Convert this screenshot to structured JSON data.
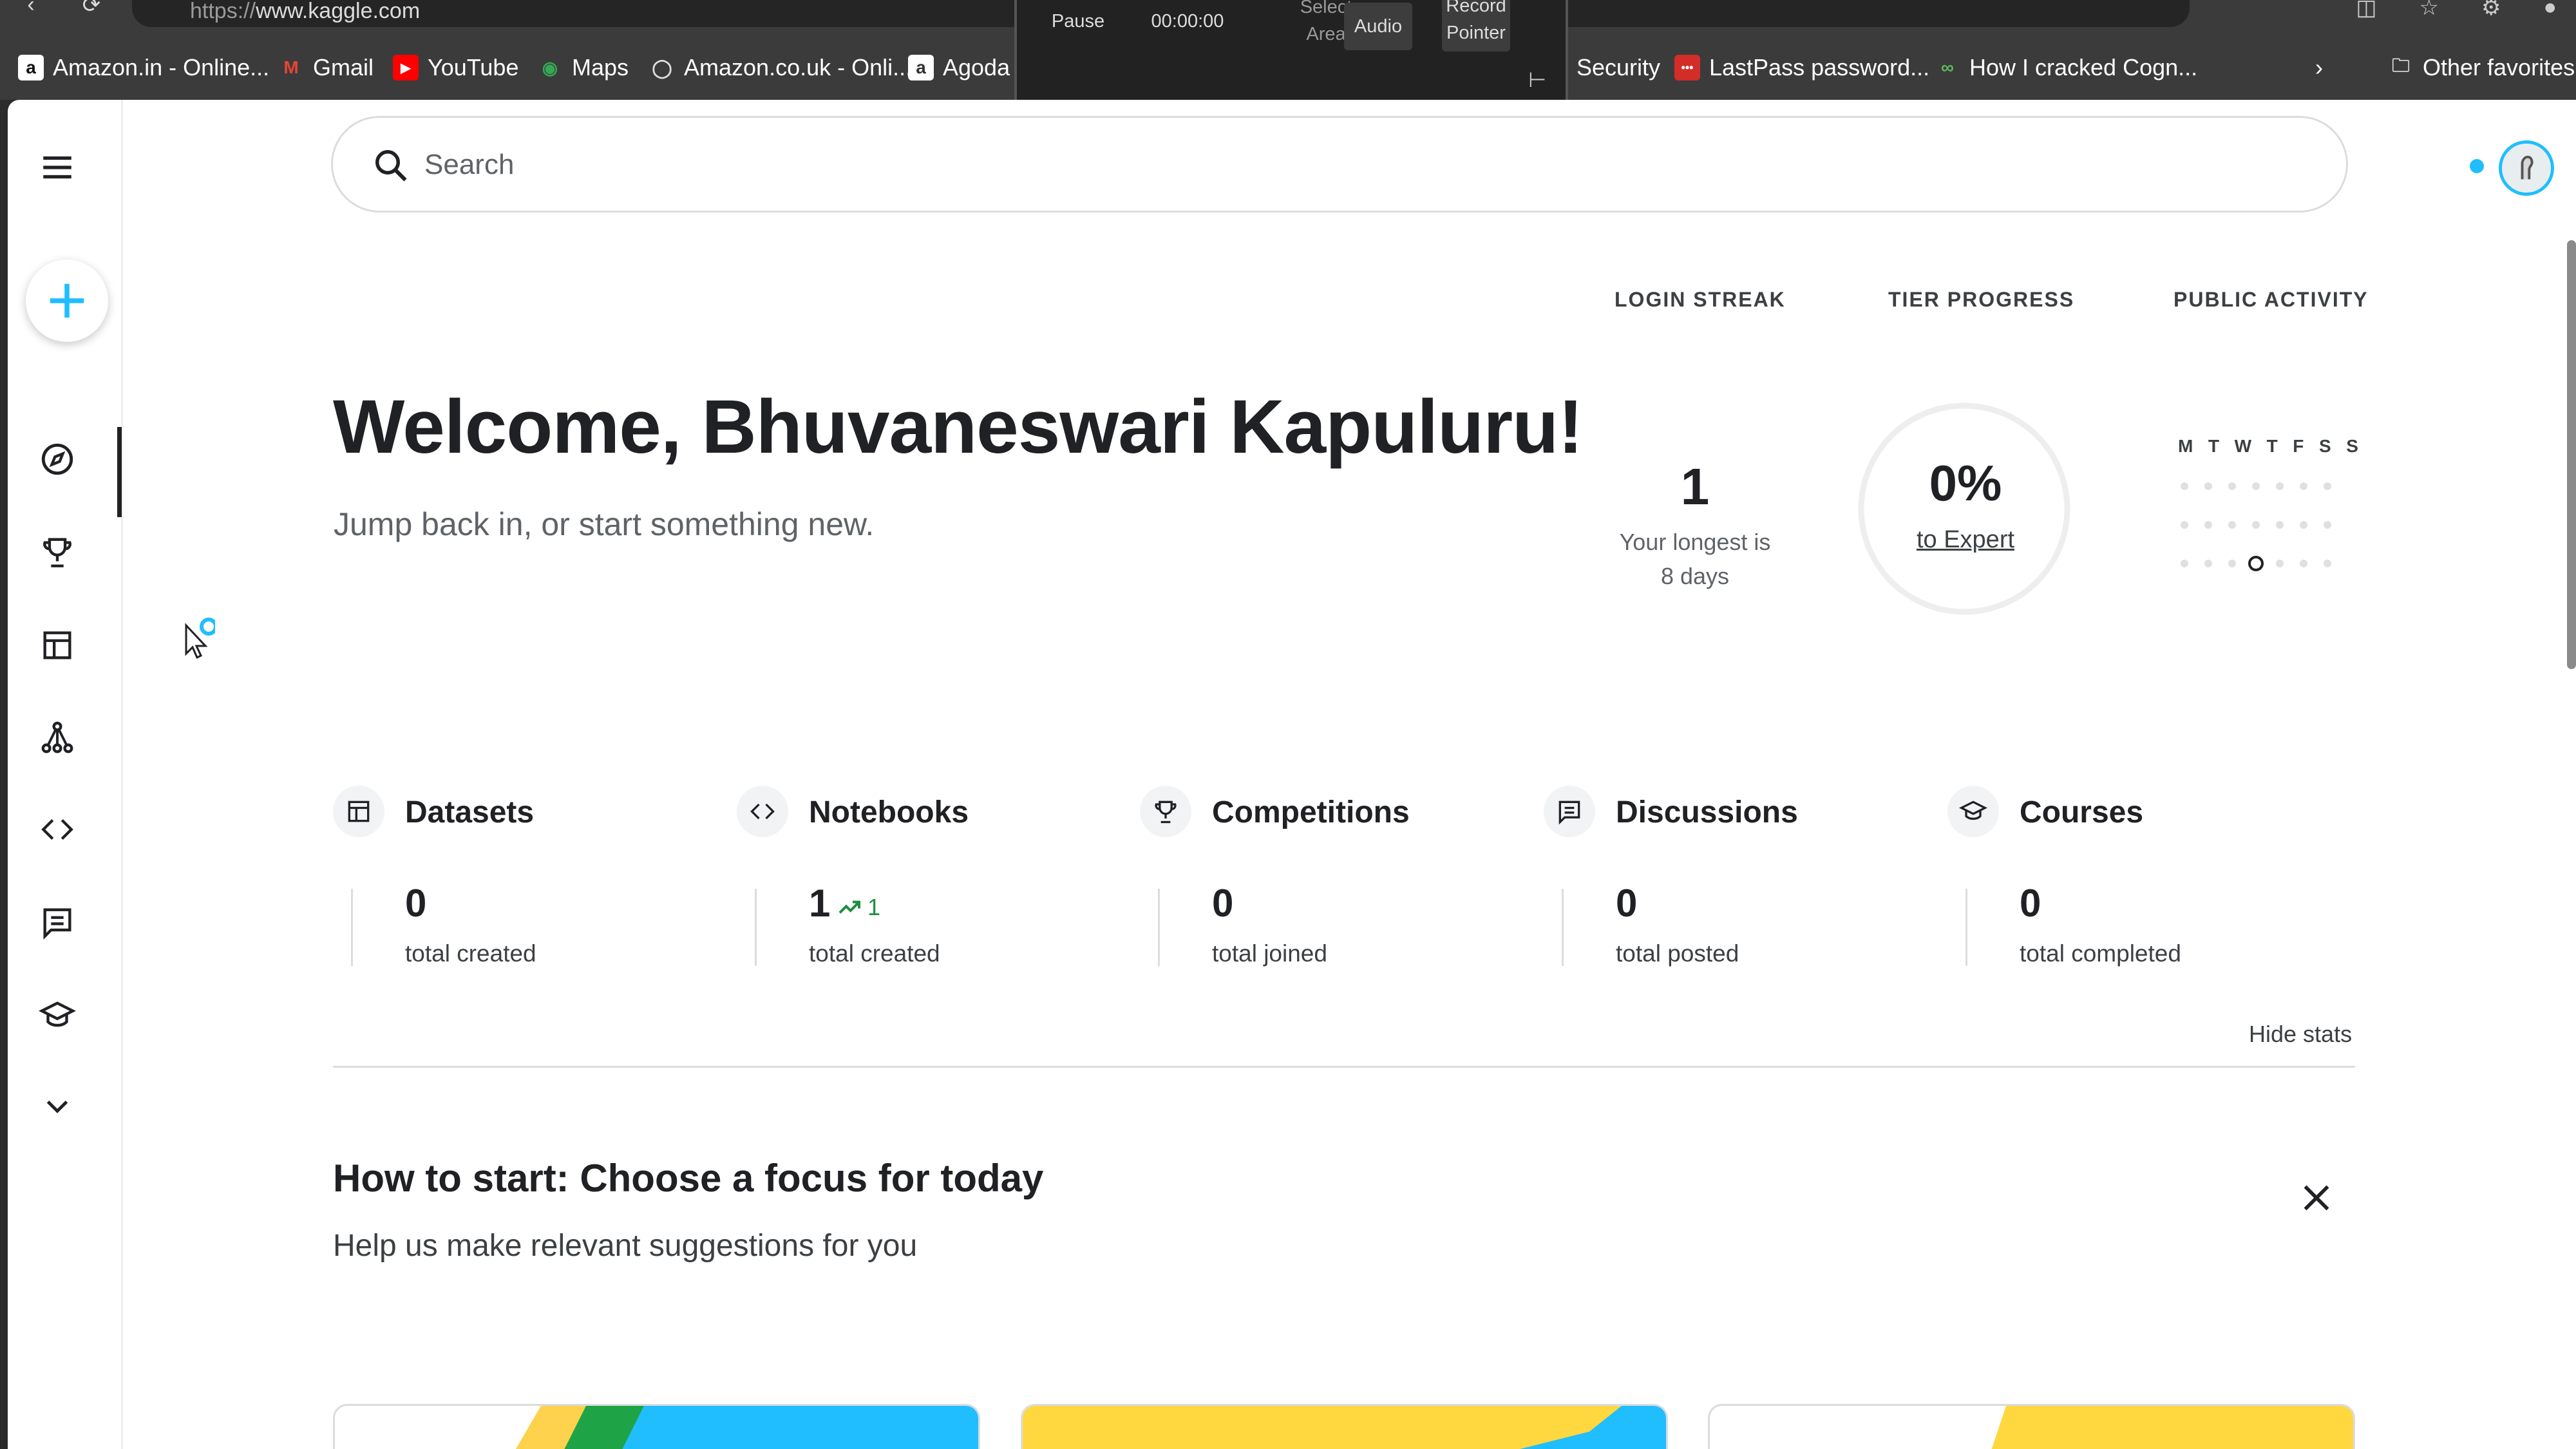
{
  "browser": {
    "url_scheme": "https://",
    "url_host": "www.kaggle.com",
    "bookmarks": [
      {
        "label": "Amazon.in - Online...",
        "icon": "amazon-icon"
      },
      {
        "label": "Gmail",
        "icon": "gmail-icon"
      },
      {
        "label": "YouTube",
        "icon": "youtube-icon"
      },
      {
        "label": "Maps",
        "icon": "maps-pin-icon"
      },
      {
        "label": "Amazon.co.uk - Onli...",
        "icon": "globe-icon"
      },
      {
        "label": "Agoda",
        "icon": "agoda-icon"
      },
      {
        "label": "Security",
        "icon": ""
      },
      {
        "label": "LastPass password...",
        "icon": "lastpass-icon"
      },
      {
        "label": "How I cracked Cogn...",
        "icon": "link-icon"
      }
    ],
    "other_favorites": "Other favorites"
  },
  "recorder": {
    "pause": "Pause",
    "time": "00:00:00",
    "select_area_1": "Select",
    "select_area_2": "Area",
    "audio": "Audio",
    "record_pointer_1": "Record",
    "record_pointer_2": "Pointer"
  },
  "search": {
    "placeholder": "Search"
  },
  "welcome": {
    "title": "Welcome, Bhuvaneswari Kapuluru!",
    "subtitle": "Jump back in, or start something new."
  },
  "stats": {
    "login_streak": {
      "heading": "LOGIN STREAK",
      "value": "1",
      "sub_1": "Your longest is",
      "sub_2": "8 days"
    },
    "tier_progress": {
      "heading": "TIER PROGRESS",
      "value": "0%",
      "progress": 0,
      "link": "to Expert"
    },
    "public_activity": {
      "heading": "PUBLIC ACTIVITY",
      "days": [
        "M",
        "T",
        "W",
        "T",
        "F",
        "S",
        "S"
      ],
      "weeks": 3,
      "highlight": {
        "week": 3,
        "day": 4
      }
    }
  },
  "categories": [
    {
      "name": "Datasets",
      "icon": "table-icon",
      "value": "0",
      "label": "total created",
      "trend": ""
    },
    {
      "name": "Notebooks",
      "icon": "code-icon",
      "value": "1",
      "label": "total created",
      "trend": "1"
    },
    {
      "name": "Competitions",
      "icon": "trophy-icon",
      "value": "0",
      "label": "total joined",
      "trend": ""
    },
    {
      "name": "Discussions",
      "icon": "discussion-icon",
      "value": "0",
      "label": "total posted",
      "trend": ""
    },
    {
      "name": "Courses",
      "icon": "school-icon",
      "value": "0",
      "label": "total completed",
      "trend": ""
    }
  ],
  "hide_stats": "Hide stats",
  "focus": {
    "title": "How to start: Choose a focus for today",
    "subtitle": "Help us make relevant suggestions for you"
  },
  "colors": {
    "accent": "#20beff",
    "trend_green": "#1e8e3e",
    "text": "#202124",
    "muted": "#5f6368"
  }
}
